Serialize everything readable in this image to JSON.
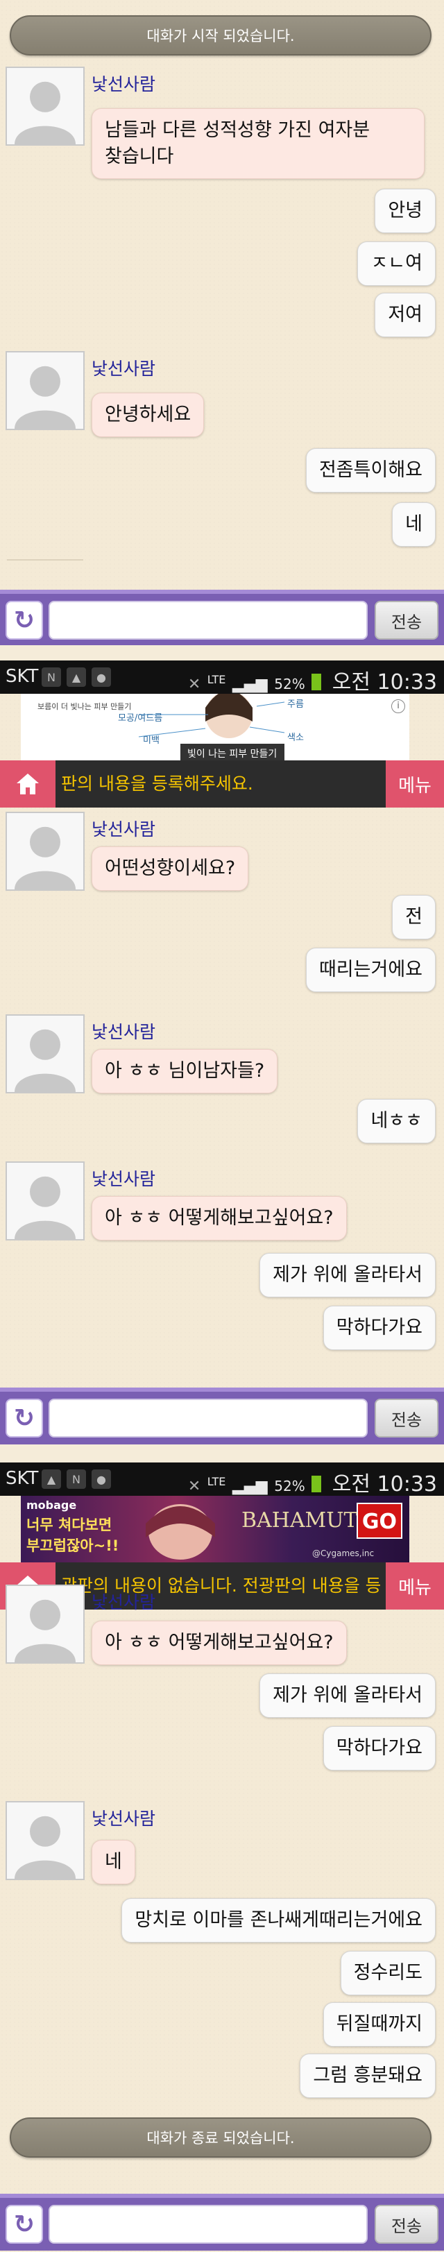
{
  "system": {
    "chat_started": "대화가 시작 되었습니다.",
    "chat_ended": "대화가 종료 되었습니다."
  },
  "stranger_name": "낯선사람",
  "input": {
    "send_label": "전송",
    "refresh_glyph": "↻"
  },
  "statusbar": {
    "carrier": "SKT",
    "network": "LTE",
    "battery": "52%",
    "time": "오전 10:33"
  },
  "notice": {
    "menu_label": "메뉴",
    "text_1": "판의 내용을 등록해주세요.",
    "text_2": "광판의 내용이 없습니다. 전광판의 내용을 등"
  },
  "ads": {
    "ad1_line1": "보름이 더 빛나는 피부 만들기",
    "ad1_caption": "빛이 나는 피부 만들기",
    "ad1_labels": [
      "모공/여드름",
      "주름",
      "미백",
      "색소"
    ],
    "ad2_brand": "mobage",
    "ad2_line1": "너무 쳐다보면",
    "ad2_line2": "부끄럽잖아~!!",
    "ad2_logo": "BAHAMUT",
    "ad2_go": "GO",
    "ad2_copy": "@Cygames,inc"
  },
  "conversation": {
    "s1_in1": "남들과 다른 성적성향 가진 여자분",
    "s1_in1b": "찾습니다",
    "s1_out1": "안녕",
    "s1_out2": "ㅈㄴ여",
    "s1_out3": "저여",
    "s1_in2": "안녕하세요",
    "s1_out4": "전좀특이해요",
    "s1_out5": "네",
    "s2_in1": "어떤성향이세요?",
    "s2_out1": "전",
    "s2_out2": "때리는거에요",
    "s2_in2": "아 ㅎㅎ 님이남자들?",
    "s2_out3": "네ㅎㅎ",
    "s2_in3": "아 ㅎㅎ 어떻게해보고싶어요?",
    "s2_out4": "제가 위에 올라타서",
    "s2_out5": "막하다가요",
    "s3_in1": "아 ㅎㅎ 어떻게해보고싶어요?",
    "s3_out1": "제가 위에 올라타서",
    "s3_out2": "막하다가요",
    "s3_in2": "네",
    "s3_out3": "망치로 이마를 존나쌔게때리는거에요",
    "s3_out4": "정수리도",
    "s3_out5": "뒤질때까지",
    "s3_out6": "그럼 흥분돼요"
  }
}
